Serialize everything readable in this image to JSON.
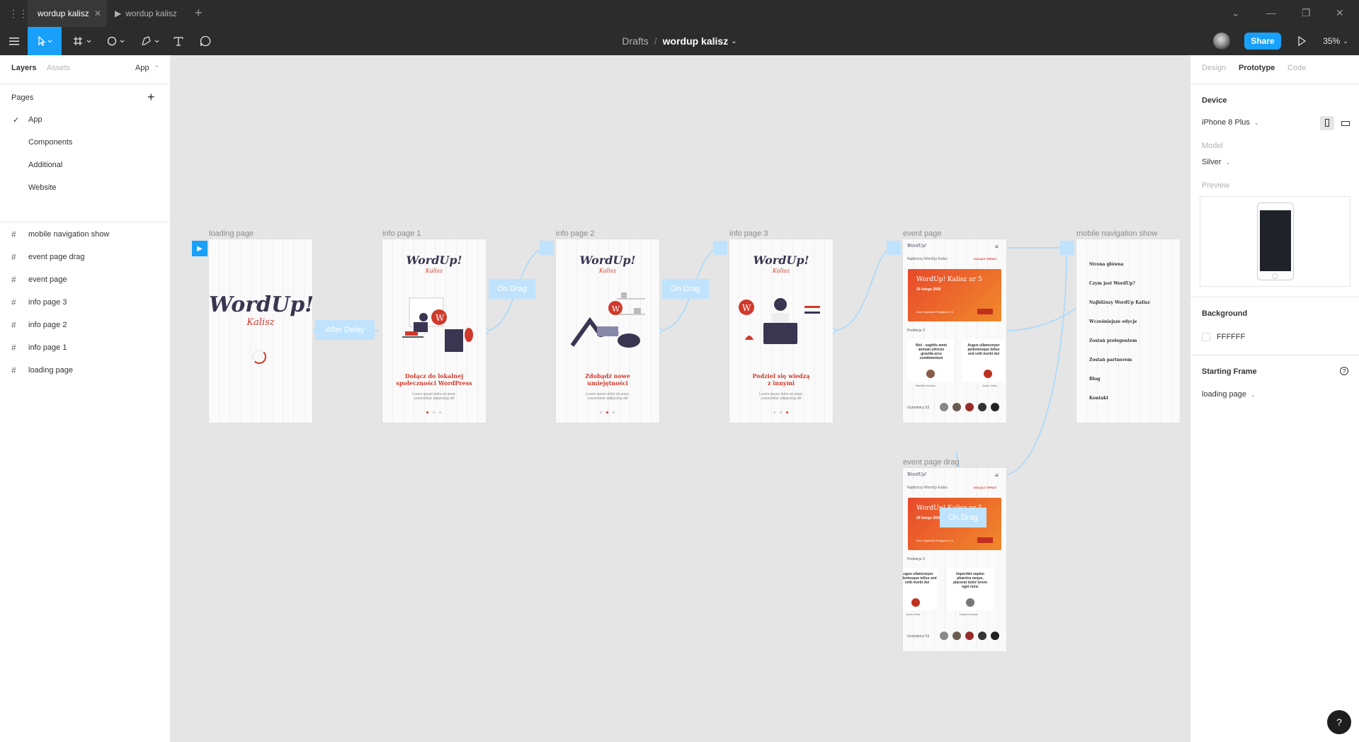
{
  "tabs": [
    {
      "label": "wordup kalisz"
    },
    {
      "label": "wordup kalisz"
    }
  ],
  "toolbar": {
    "breadcrumb_parent": "Drafts",
    "breadcrumb_sep": "/",
    "file_name": "wordup kalisz",
    "share_label": "Share",
    "zoom": "35%"
  },
  "left_panel": {
    "tab_layers": "Layers",
    "tab_assets": "Assets",
    "page_selector": "App",
    "pages_heading": "Pages",
    "pages": [
      "App",
      "Components",
      "Additional",
      "Website"
    ],
    "layers": [
      "mobile navigation show",
      "event page drag",
      "event page",
      "info page 3",
      "info page 2",
      "info page 1",
      "loading page"
    ]
  },
  "right_panel": {
    "tab_design": "Design",
    "tab_prototype": "Prototype",
    "tab_code": "Code",
    "device_heading": "Device",
    "device_value": "iPhone 8 Plus",
    "model_label": "Model",
    "model_value": "Silver",
    "preview_label": "Preview",
    "background_heading": "Background",
    "background_value": "FFFFFF",
    "starting_frame_heading": "Starting Frame",
    "starting_frame_value": "loading page"
  },
  "canvas": {
    "frames": {
      "loading": "loading page",
      "info1": "info page 1",
      "info2": "info page 2",
      "info3": "info page 3",
      "event": "event page",
      "mobilenav": "mobile navigation show",
      "eventdrag": "event page drag"
    },
    "proto_labels": {
      "after_delay": "After Delay",
      "on_drag_1": "On Drag",
      "on_drag_2": "On Drag",
      "on_drag_3": "On Drag"
    },
    "content": {
      "logo": "WordUp!",
      "logo_sub": "Kalisz",
      "info1_title": "Dołącz do lokalnej społeczności WordPress",
      "info2_title": "Zdobądź nowe umiejętności",
      "info3_title": "Podziel się wiedzą z innymi",
      "lorem": "Lorem ipsum dolor sit amet, consectetur adipiscing elit",
      "event_nearest": "Najbliższy WordUp Kalisz",
      "event_join": "DOŁĄCZ TERAZ!",
      "event_card_title": "WordUp! Kalisz nr 5",
      "event_date": "20 lutego 2020",
      "event_place": "Dom Sąsiedzki Podgórze 3-4",
      "event_lectures": "Prelekcje 3",
      "event_participants": "Uczestnicy 53",
      "speaker1": "Martina Kovacs",
      "speaker2": "Jocko Oma",
      "speaker3": "Daniel Kovacs",
      "talk1": "Nisl - sagittis amet aenean ultrices gravida arcu condimentum",
      "talk2": "Augue ullamcorper pellentesque tellus sed velit morbi dui",
      "talk3": "Imperdiet sapien pharetra neque, placerat dolor lorem eget nunc",
      "nav_links": [
        "Strona główna",
        "Czym jest WordUp?",
        "Najbliższy WordUp Kalisz",
        "Wcześniejsze edycje",
        "Zostań prelegentem",
        "Zostań partnerem",
        "Blog",
        "Kontakt"
      ]
    }
  },
  "help_label": "?"
}
